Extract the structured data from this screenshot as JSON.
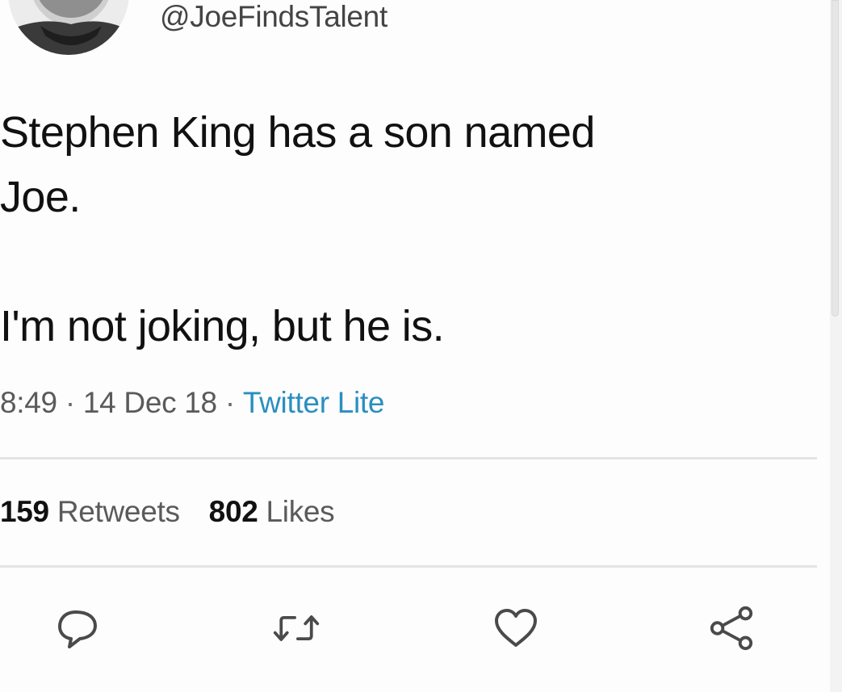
{
  "tweet": {
    "handle": "@JoeFindsTalent",
    "text_line1": "Stephen King has a son named",
    "text_line2": "Joe.",
    "text_line3": "I'm not joking, but he is.",
    "time": "8:49",
    "date": "14 Dec 18",
    "source": "Twitter Lite",
    "separator": "·"
  },
  "stats": {
    "retweets_count": "159",
    "retweets_label": "Retweets",
    "likes_count": "802",
    "likes_label": "Likes"
  },
  "actions": {
    "reply_icon": "reply-icon",
    "retweet_icon": "retweet-icon",
    "like_icon": "heart-icon",
    "share_icon": "share-icon"
  },
  "colors": {
    "source_link": "#2a8fbf",
    "text": "#111111",
    "secondary_text": "#5a5a5a"
  }
}
